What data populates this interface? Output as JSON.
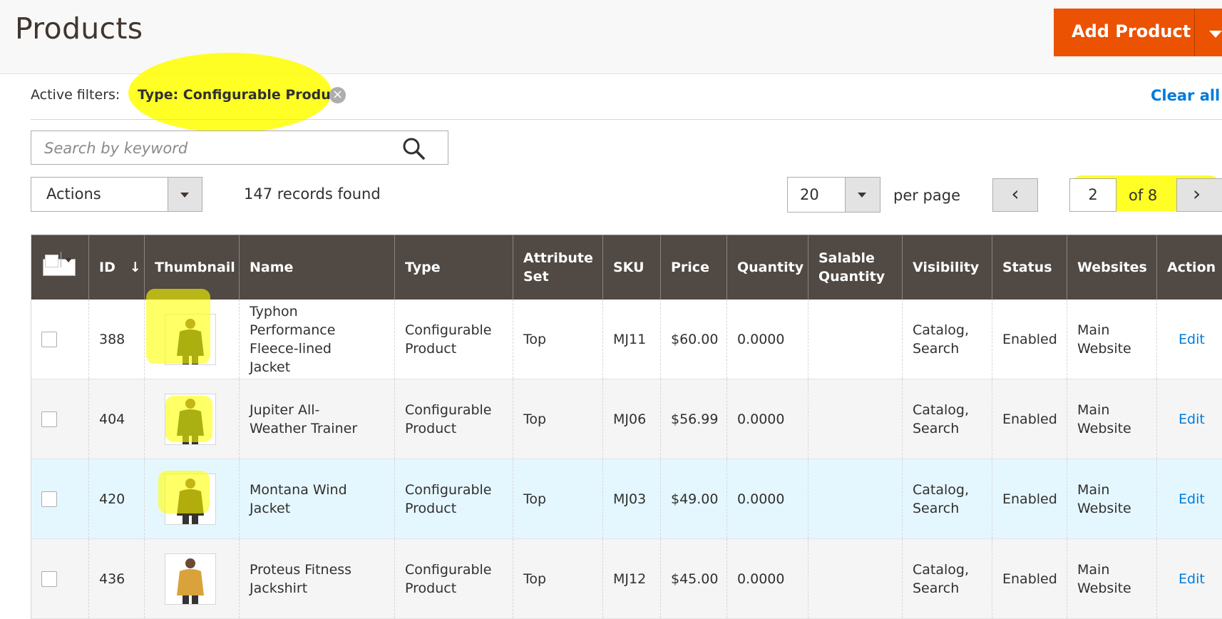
{
  "page": {
    "title": "Products"
  },
  "header": {
    "add_product_label": "Add Product"
  },
  "filters": {
    "label": "Active filters:",
    "chip": "Type: Configurable Product",
    "clear_all": "Clear all"
  },
  "search": {
    "placeholder": "Search by keyword"
  },
  "toolbar": {
    "actions_label": "Actions",
    "records_found": "147 records found",
    "per_page_value": "20",
    "per_page_label": "per page"
  },
  "pagination": {
    "current_page": "2",
    "total_pages_label": "of 8",
    "prev_icon": "chevron-left-icon",
    "next_icon": "chevron-right-icon"
  },
  "table": {
    "columns": [
      "ID",
      "Thumbnail",
      "Name",
      "Type",
      "Attribute Set",
      "SKU",
      "Price",
      "Quantity",
      "Salable Quantity",
      "Visibility",
      "Status",
      "Websites",
      "Action"
    ],
    "sort_indicator": "↓",
    "rows": [
      {
        "id": "388",
        "name": "Typhon Performance Fleece-lined Jacket",
        "type": "Configurable Product",
        "attribute_set": "Top",
        "sku": "MJ11",
        "price": "$60.00",
        "quantity": "0.0000",
        "salable_quantity": "",
        "visibility": "Catalog, Search",
        "status": "Enabled",
        "websites": "Main Website",
        "action": "Edit",
        "jacket_color": "#2e3a2a"
      },
      {
        "id": "404",
        "name": "Jupiter All-Weather Trainer",
        "type": "Configurable Product",
        "attribute_set": "Top",
        "sku": "MJ06",
        "price": "$56.99",
        "quantity": "0.0000",
        "salable_quantity": "",
        "visibility": "Catalog, Search",
        "status": "Enabled",
        "websites": "Main Website",
        "action": "Edit",
        "jacket_color": "#2b3b2b"
      },
      {
        "id": "420",
        "name": "Montana Wind Jacket",
        "type": "Configurable Product",
        "attribute_set": "Top",
        "sku": "MJ03",
        "price": "$49.00",
        "quantity": "0.0000",
        "salable_quantity": "",
        "visibility": "Catalog, Search",
        "status": "Enabled",
        "websites": "Main Website",
        "action": "Edit",
        "jacket_color": "#3a3320"
      },
      {
        "id": "436",
        "name": "Proteus Fitness Jackshirt",
        "type": "Configurable Product",
        "attribute_set": "Top",
        "sku": "MJ12",
        "price": "$45.00",
        "quantity": "0.0000",
        "salable_quantity": "",
        "visibility": "Catalog, Search",
        "status": "Enabled",
        "websites": "Main Website",
        "action": "Edit",
        "jacket_color": "#d9a23a"
      }
    ]
  },
  "colors": {
    "accent": "#eb5202",
    "header_bg": "#514943",
    "link": "#007bdb",
    "highlight": "#ffff00"
  }
}
